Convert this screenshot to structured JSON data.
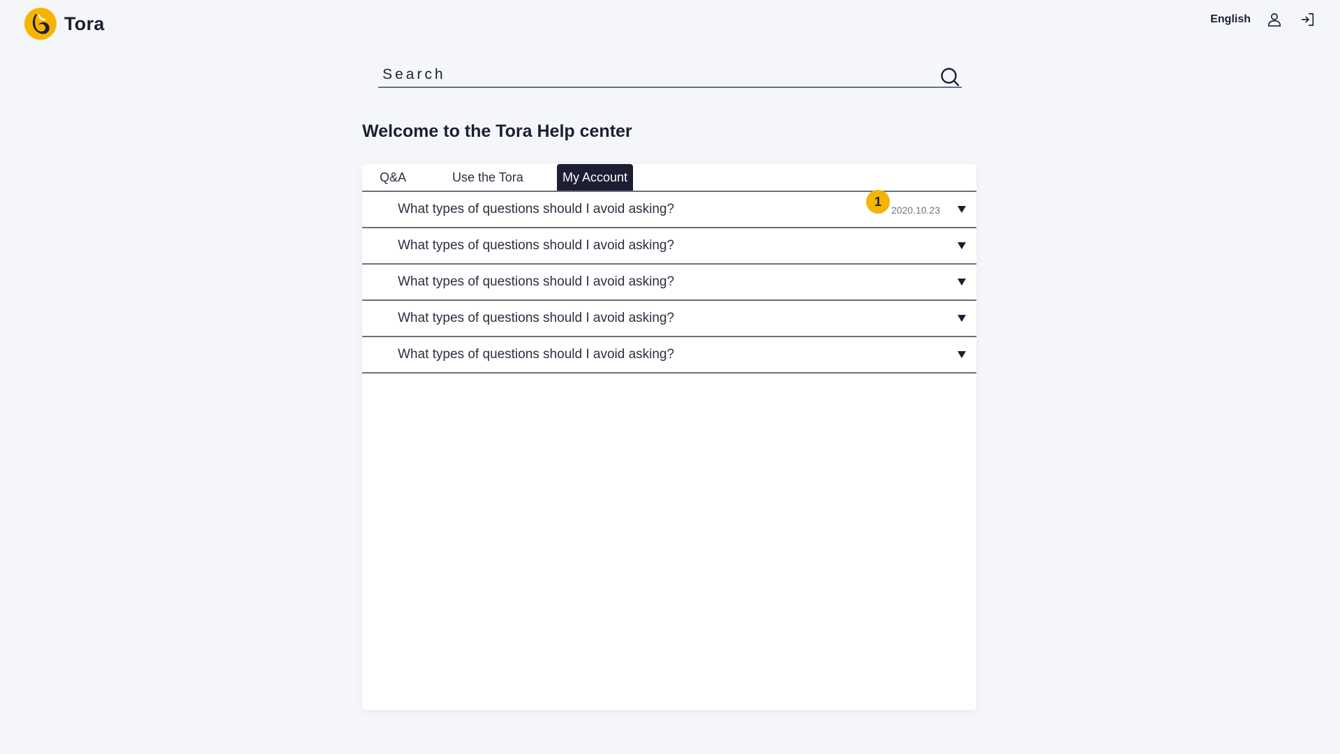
{
  "header": {
    "logo_text": "Tora",
    "language": "English",
    "icons": [
      "user-icon",
      "sign-in-icon"
    ]
  },
  "search": {
    "placeholder": "Search",
    "icon": "search-icon"
  },
  "page": {
    "title": "Welcome to the Tora Help center"
  },
  "tabs": [
    {
      "label": "Q&A",
      "active": false
    },
    {
      "label": "Use the Tora",
      "active": false
    },
    {
      "label": "My Account",
      "active": true
    }
  ],
  "faq": {
    "items": [
      {
        "question": "What types of questions should I avoid asking?",
        "date": "2020.10.23",
        "badge": "1"
      },
      {
        "question": "What types of questions should I avoid asking?"
      },
      {
        "question": "What types of questions should I avoid asking?"
      },
      {
        "question": "What types of questions should I avoid asking?"
      },
      {
        "question": "What types of questions should I avoid asking?"
      }
    ]
  },
  "colors": {
    "background": "#f5f6fa",
    "dark": "#1c1f33",
    "accent": "#f5b400",
    "card": "#ffffff"
  }
}
